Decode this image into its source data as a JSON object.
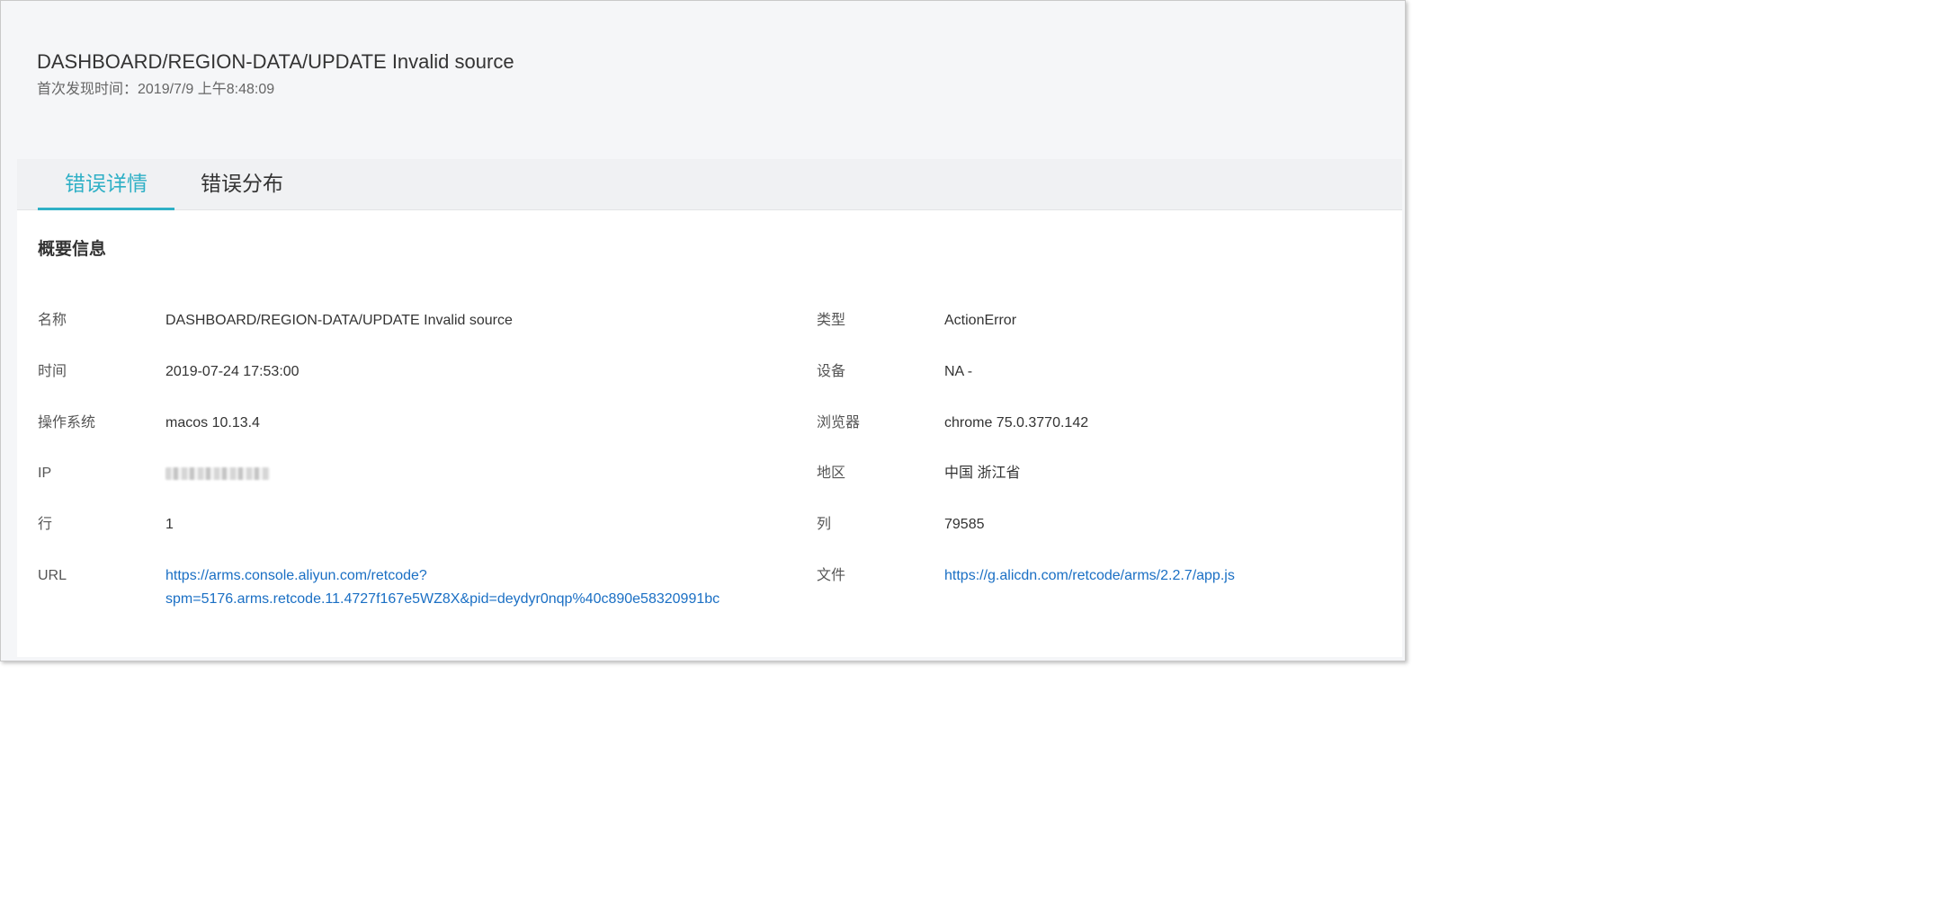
{
  "header": {
    "title": "DASHBOARD/REGION-DATA/UPDATE Invalid source",
    "first_seen": "首次发现时间：2019/7/9 上午8:48:09"
  },
  "tabs": [
    {
      "label": "错误详情",
      "active": true
    },
    {
      "label": "错误分布",
      "active": false
    }
  ],
  "overview": {
    "section_title": "概要信息",
    "rows": [
      {
        "left_label": "名称",
        "left_value": "DASHBOARD/REGION-DATA/UPDATE Invalid source",
        "right_label": "类型",
        "right_value": "ActionError"
      },
      {
        "left_label": "时间",
        "left_value": "2019-07-24 17:53:00",
        "right_label": "设备",
        "right_value": "NA -"
      },
      {
        "left_label": "操作系统",
        "left_value": "macos 10.13.4",
        "right_label": "浏览器",
        "right_value": "chrome 75.0.3770.142"
      },
      {
        "left_label": "IP",
        "left_value": "",
        "right_label": "地区",
        "right_value": "中国 浙江省"
      },
      {
        "left_label": "行",
        "left_value": "1",
        "right_label": "列",
        "right_value": "79585"
      },
      {
        "left_label": "URL",
        "left_value_line1": "https://arms.console.aliyun.com/retcode?",
        "left_value_line2": "spm=5176.arms.retcode.11.4727f167e5WZ8X&pid=deydyr0nqp%40c890e58320991bc",
        "right_label": "文件",
        "right_value": "https://g.alicdn.com/retcode/arms/2.2.7/app.js"
      }
    ]
  },
  "colors": {
    "accent": "#2fb0c6",
    "link": "#1a6fc4",
    "background": "#f5f6f8"
  }
}
